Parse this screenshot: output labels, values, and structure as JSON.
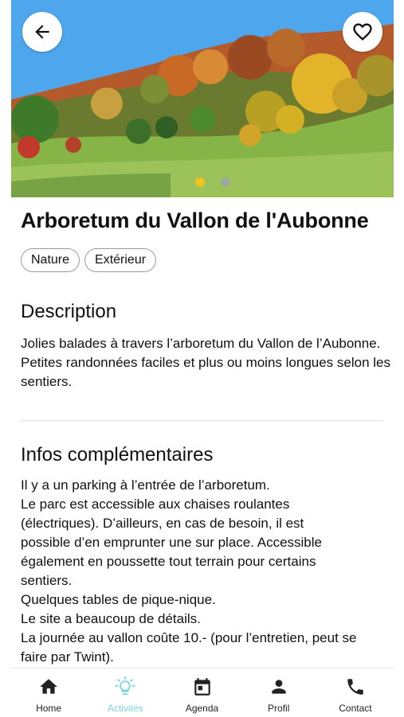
{
  "header": {
    "back_icon": "arrow-left-icon",
    "favorite_icon": "heart-outline-icon"
  },
  "carousel": {
    "slide_count": 2,
    "active_index": 0,
    "active_dot_color": "#f0c419"
  },
  "activity": {
    "title": "Arboretum du Vallon de l'Aubonne",
    "tags": [
      "Nature",
      "Extérieur"
    ]
  },
  "description": {
    "heading": "Description",
    "text": "Jolies balades à travers l’arboretum du Vallon de l’Aubonne. Petites randonnées faciles et plus ou moins longues selon les sentiers."
  },
  "infos": {
    "heading": "Infos complémentaires",
    "lines": [
      "Il y a un parking à l’entrée de l’arboretum.",
      "Le parc est accessible aux chaises roulantes",
      "(électriques). D’ailleurs, en cas de besoin, il est",
      "possible d’en emprunter une sur place. Accessible",
      "également en poussette tout terrain pour certains",
      "sentiers.",
      "Quelques tables de pique-nique.",
      "Le site a beaucoup de détails.",
      "La journée au vallon coûte 10.- (pour l’entretien, peut se",
      "faire par Twint)."
    ]
  },
  "bottom_nav": {
    "active_color": "#7ad4e0",
    "items": [
      {
        "label": "Home",
        "icon": "home-icon"
      },
      {
        "label": "Activités",
        "icon": "lightbulb-icon"
      },
      {
        "label": "Agenda",
        "icon": "calendar-icon"
      },
      {
        "label": "Profil",
        "icon": "person-icon"
      },
      {
        "label": "Contact",
        "icon": "phone-icon"
      }
    ]
  }
}
